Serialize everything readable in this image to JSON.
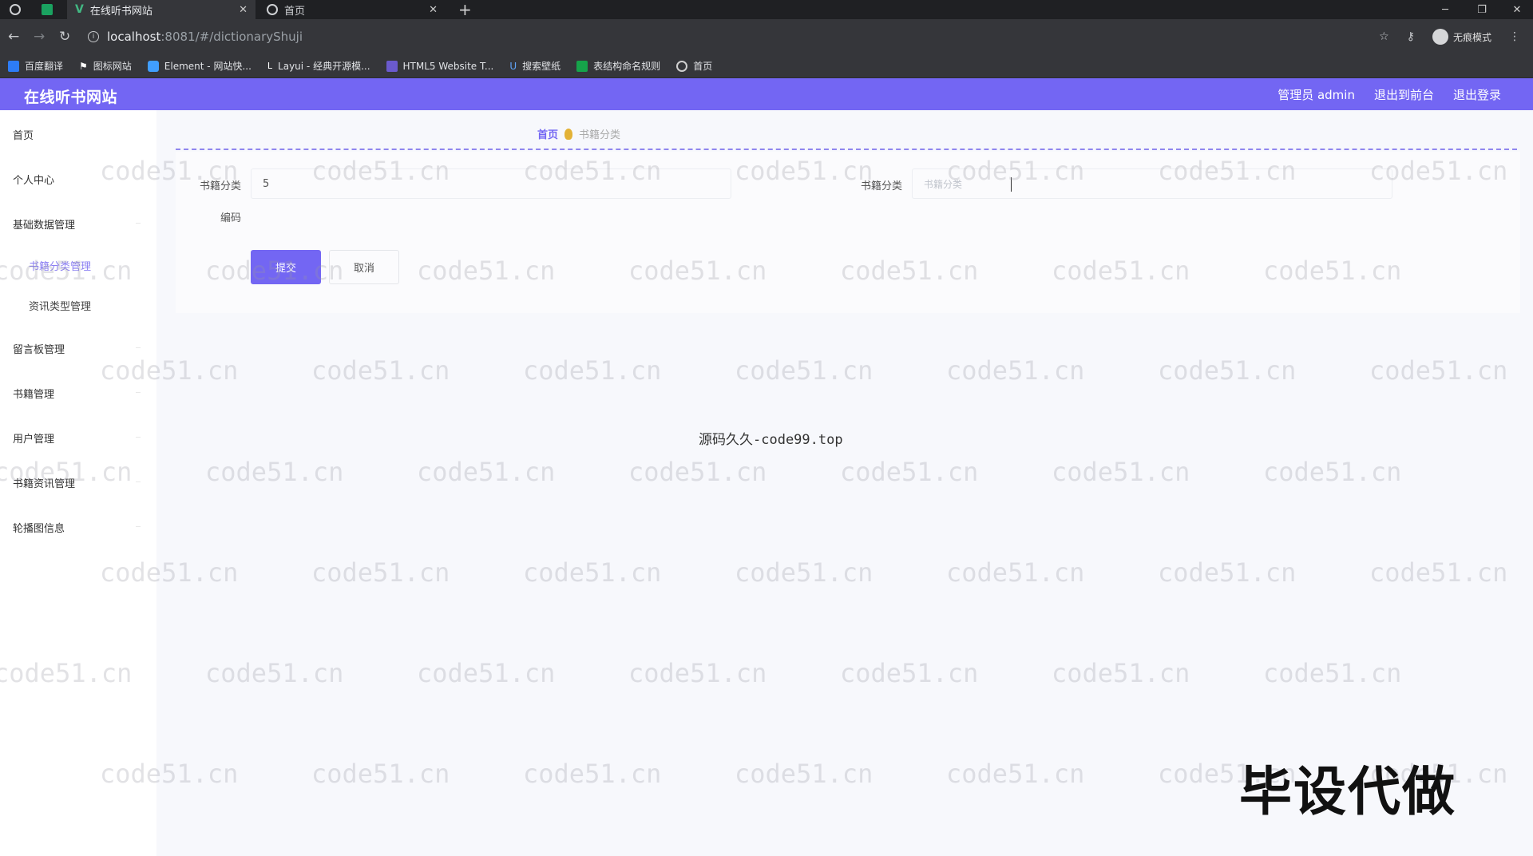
{
  "browser": {
    "tabs": [
      {
        "title": ""
      },
      {
        "title": ""
      },
      {
        "title": "在线听书网站",
        "active": true
      },
      {
        "title": "首页"
      }
    ],
    "url_host": "localhost",
    "url_path": ":8081/#/dictionaryShuji",
    "incognito_label": "无痕模式",
    "bookmarks": [
      {
        "label": "百度翻译",
        "color": "#2d7cf6"
      },
      {
        "label": "图标网站",
        "color": "#ffffff"
      },
      {
        "label": "Element - 网站快...",
        "color": "#409eff"
      },
      {
        "label": "Layui - 经典开源模...",
        "color": "#ffffff"
      },
      {
        "label": "HTML5 Website T...",
        "color": "#6a5acd"
      },
      {
        "label": "搜索壁纸",
        "color": "#3b82f6"
      },
      {
        "label": "表结构命名规则",
        "color": "#16a34a"
      },
      {
        "label": "首页",
        "color": "#d0d0d0"
      }
    ]
  },
  "header": {
    "brand": "在线听书网站",
    "admin_label": "管理员 admin",
    "front_label": "退出到前台",
    "logout_label": "退出登录",
    "accent": "#7366f3"
  },
  "sidebar": {
    "items": [
      {
        "label": "首页"
      },
      {
        "label": "个人中心"
      },
      {
        "label": "基础数据管理"
      },
      {
        "label": "书籍分类管理",
        "active": true
      },
      {
        "label": "资讯类型管理"
      },
      {
        "label": "留言板管理"
      },
      {
        "label": "书籍管理"
      },
      {
        "label": "用户管理"
      },
      {
        "label": "书籍资讯管理"
      },
      {
        "label": "轮播图信息"
      }
    ]
  },
  "breadcrumb": {
    "home": "首页",
    "current": "书籍分类"
  },
  "form": {
    "code_label_1": "书籍分类",
    "code_label_2": "编码",
    "code_value": "5",
    "name_label": "书籍分类",
    "name_placeholder": "书籍分类",
    "submit_label": "提交",
    "cancel_label": "取消"
  },
  "watermarks": {
    "tile": "code51.cn",
    "center": "源码久久-code99.top",
    "corner": "毕设代做"
  }
}
